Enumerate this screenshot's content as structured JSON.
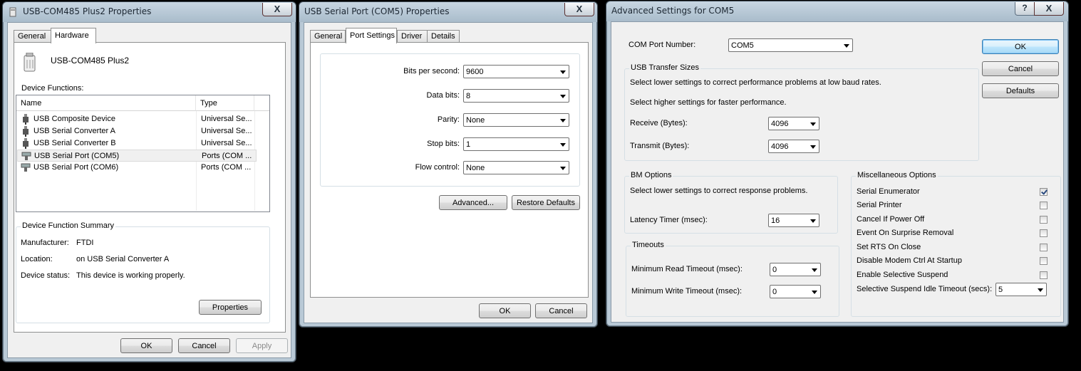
{
  "colors": {
    "desktop": "#000000",
    "frame": "#b9c9d6",
    "client": "#f0f0f0",
    "default_button": "#bee6fd"
  },
  "window1": {
    "title": "USB-COM485 Plus2 Properties",
    "close": "X",
    "tabs": [
      {
        "label": "General"
      },
      {
        "label": "Hardware"
      }
    ],
    "device_name": "USB-COM485 Plus2",
    "device_functions_label": "Device Functions:",
    "columns": [
      "Name",
      "Type"
    ],
    "rows": [
      {
        "name": "USB Composite Device",
        "type": "Universal Se..."
      },
      {
        "name": "USB Serial Converter A",
        "type": "Universal Se..."
      },
      {
        "name": "USB Serial Converter B",
        "type": "Universal Se..."
      },
      {
        "name": "USB Serial Port (COM5)",
        "type": "Ports (COM ..."
      },
      {
        "name": "USB Serial Port (COM6)",
        "type": "Ports (COM ..."
      }
    ],
    "summary_title": "Device Function Summary",
    "manufacturer_label": "Manufacturer:",
    "manufacturer_value": "FTDI",
    "location_label": "Location:",
    "location_value": "on USB Serial Converter A",
    "status_label": "Device status:",
    "status_value": "This device is working properly.",
    "properties_button": "Properties",
    "ok": "OK",
    "cancel": "Cancel",
    "apply": "Apply"
  },
  "window2": {
    "title": "USB Serial Port (COM5) Properties",
    "close": "X",
    "tabs": [
      {
        "label": "General"
      },
      {
        "label": "Port Settings"
      },
      {
        "label": "Driver"
      },
      {
        "label": "Details"
      }
    ],
    "fields": [
      {
        "label": "Bits per second:",
        "value": "9600"
      },
      {
        "label": "Data bits:",
        "value": "8"
      },
      {
        "label": "Parity:",
        "value": "None"
      },
      {
        "label": "Stop bits:",
        "value": "1"
      },
      {
        "label": "Flow control:",
        "value": "None"
      }
    ],
    "advanced_button": "Advanced...",
    "restore_button": "Restore Defaults",
    "ok": "OK",
    "cancel": "Cancel"
  },
  "window3": {
    "title": "Advanced Settings for COM5",
    "help": "?",
    "close": "X",
    "com_port_label": "COM Port Number:",
    "com_port_value": "COM5",
    "ok": "OK",
    "cancel": "Cancel",
    "defaults": "Defaults",
    "usb_group": "USB Transfer Sizes",
    "usb_text1": "Select lower settings to correct performance problems at low baud rates.",
    "usb_text2": "Select higher settings for faster performance.",
    "receive_label": "Receive (Bytes):",
    "receive_value": "4096",
    "transmit_label": "Transmit (Bytes):",
    "transmit_value": "4096",
    "bm_group": "BM Options",
    "bm_text": "Select lower settings to correct response problems.",
    "latency_label": "Latency Timer (msec):",
    "latency_value": "16",
    "timeouts_group": "Timeouts",
    "read_label": "Minimum Read Timeout (msec):",
    "read_value": "0",
    "write_label": "Minimum Write Timeout (msec):",
    "write_value": "0",
    "misc_group": "Miscellaneous Options",
    "misc": [
      {
        "label": "Serial Enumerator",
        "checked": true
      },
      {
        "label": "Serial Printer",
        "checked": false
      },
      {
        "label": "Cancel If Power Off",
        "checked": false
      },
      {
        "label": "Event On Surprise Removal",
        "checked": false
      },
      {
        "label": "Set RTS On Close",
        "checked": false
      },
      {
        "label": "Disable Modem Ctrl At Startup",
        "checked": false
      },
      {
        "label": "Enable Selective Suspend",
        "checked": false
      }
    ],
    "idle_label": "Selective Suspend Idle Timeout (secs):",
    "idle_value": "5"
  }
}
